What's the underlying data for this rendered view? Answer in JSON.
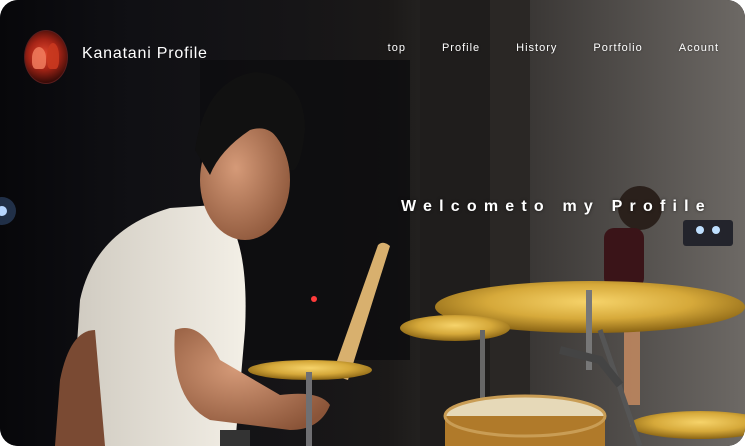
{
  "header": {
    "site_title": "Kanatani Profile",
    "logo_icon": "drummer-photo-logo"
  },
  "nav": {
    "items": [
      {
        "label": "top"
      },
      {
        "label": "Profile"
      },
      {
        "label": "History"
      },
      {
        "label": "Portfolio"
      },
      {
        "label": "Acount"
      }
    ]
  },
  "hero": {
    "headline": "Welcometo my Profile",
    "image": "drummer-on-stage-photo"
  },
  "colors": {
    "text": "#ffffff",
    "cymbal": "#d6a93a",
    "logo_red": "#c0311c"
  }
}
